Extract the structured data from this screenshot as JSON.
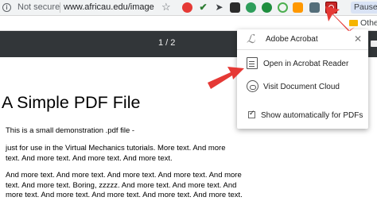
{
  "browser": {
    "security_label": "Not secure",
    "url": "www.africau.edu/images/d...",
    "paused_label": "Paused",
    "bookmarks_label": "Other b",
    "extensions": [
      "red-circle-extension-icon",
      "leaf-extension-icon",
      "cursor-extension-icon",
      "dark-square-extension-icon",
      "grammarly-extension-icon",
      "evernote-extension-icon",
      "circle-extension-icon",
      "orange-extension-icon",
      "grid-extension-icon",
      "acrobat-extension-icon"
    ]
  },
  "pdf_viewer": {
    "page_counter": "1 / 2",
    "title": "A Simple PDF File",
    "paragraphs": [
      "This is a small demonstration .pdf file -",
      "just for use in the Virtual Mechanics tutorials. More text. And more\ntext. And more text. And more text. And more text.",
      "And more text. And more text. And more text. And more text. And more\ntext. And more text. Boring, zzzzz. And more text. And more text. And\nmore text. And more text. And more text. And more text. And more text."
    ]
  },
  "popup": {
    "header": "Adobe Acrobat",
    "items": [
      {
        "label": "Open in Acrobat Reader",
        "icon": "document-icon"
      },
      {
        "label": "Visit Document Cloud",
        "icon": "cloud-icon"
      }
    ],
    "checkbox_label": "Show automatically for PDFs",
    "checkbox_checked": true
  },
  "colors": {
    "annotation_arrow": "#e53935",
    "pdf_toolbar": "#323639",
    "acrobat_red": "#c62828"
  }
}
